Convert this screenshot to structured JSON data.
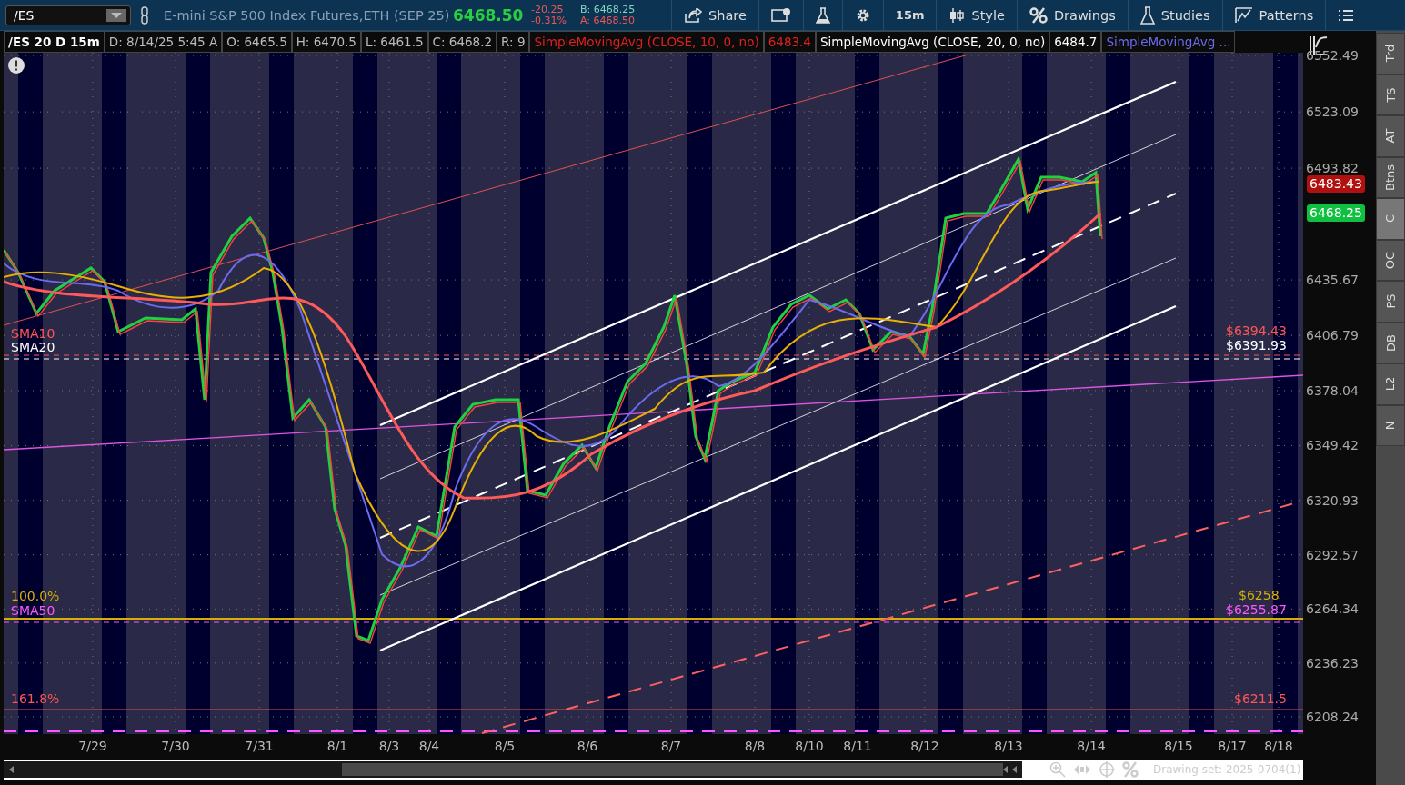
{
  "toolbar": {
    "symbol": "/ES",
    "description": "E-mini S&P 500 Index Futures,ETH (SEP 25)",
    "last": "6468.50",
    "change": "-20.25",
    "change_pct": "-0.31%",
    "bid": "B: 6468.25",
    "ask": "A: 6468.50",
    "buttons": [
      {
        "kind": "share",
        "label": "Share"
      },
      {
        "kind": "info"
      },
      {
        "kind": "flask"
      },
      {
        "kind": "gear"
      },
      {
        "kind": "text",
        "label": "15m"
      },
      {
        "kind": "style",
        "label": "Style"
      },
      {
        "kind": "drawings",
        "label": "Drawings"
      },
      {
        "kind": "studies",
        "label": "Studies"
      },
      {
        "kind": "patterns",
        "label": "Patterns"
      },
      {
        "kind": "menu"
      }
    ]
  },
  "info_bar": [
    {
      "kind": "title",
      "text": "/ES 20 D 15m"
    },
    {
      "kind": "plain",
      "text": "D: 8/14/25 5:45 A"
    },
    {
      "kind": "plain",
      "text": "O: 6465.5"
    },
    {
      "kind": "plain",
      "text": "H: 6470.5"
    },
    {
      "kind": "plain",
      "text": "L: 6461.5"
    },
    {
      "kind": "plain",
      "text": "C: 6468.2"
    },
    {
      "kind": "plain",
      "text": "R: 9"
    },
    {
      "kind": "sma10",
      "text": "SimpleMovingAvg (CLOSE, 10, 0, no)"
    },
    {
      "kind": "sma10",
      "text": "6483.4"
    },
    {
      "kind": "sma20",
      "text": "SimpleMovingAvg (CLOSE, 20, 0, no)"
    },
    {
      "kind": "sma20",
      "text": "6484.7"
    },
    {
      "kind": "sma50",
      "text": "SimpleMovingAvg ..."
    }
  ],
  "chart": {
    "y_ticks": [
      "6552.49",
      "6523.09",
      "6493.82",
      "6435.67",
      "6406.79",
      "6378.04",
      "6349.42",
      "6320.93",
      "6292.57",
      "6264.34",
      "6236.23",
      "6208.24"
    ],
    "x_labels": [
      "7/29",
      "7/30",
      "7/31",
      "8/1",
      "8/3",
      "8/4",
      "8/5",
      "8/6",
      "8/7",
      "8/8",
      "8/10",
      "8/11",
      "8/12",
      "8/13",
      "8/14",
      "8/15",
      "8/17",
      "8/18"
    ],
    "left_labels": [
      {
        "kind": "sma10",
        "text": "SMA10"
      },
      {
        "kind": "sma20",
        "text": "SMA20"
      },
      {
        "kind": "fib",
        "text": "100.0%"
      },
      {
        "kind": "sma50",
        "text": "SMA50"
      },
      {
        "kind": "ext",
        "text": "161.8%"
      }
    ],
    "right_labels": [
      {
        "kind": "sma10",
        "text": "$6394.43"
      },
      {
        "kind": "sma20",
        "text": "$6391.93"
      },
      {
        "kind": "fib",
        "text": "$6258"
      },
      {
        "kind": "sma50",
        "text": "$6255.87"
      },
      {
        "kind": "ext",
        "text": "$6211.5"
      }
    ],
    "price_tags": [
      {
        "kind": "sma10",
        "text": "6483.43"
      },
      {
        "kind": "last",
        "text": "6468.25"
      }
    ]
  },
  "side_tabs": [
    {
      "label": "Trd",
      "selected": false
    },
    {
      "label": "TS",
      "selected": false
    },
    {
      "label": "AT",
      "selected": false
    },
    {
      "label": "Btns",
      "selected": false
    },
    {
      "label": "C",
      "selected": true
    },
    {
      "label": "OC",
      "selected": false
    },
    {
      "label": "PS",
      "selected": false
    },
    {
      "label": "DB",
      "selected": false
    },
    {
      "label": "L2",
      "selected": false
    },
    {
      "label": "N",
      "selected": false
    }
  ],
  "status": {
    "drawing_set": "Drawing set: 2025-0704(1)"
  }
}
